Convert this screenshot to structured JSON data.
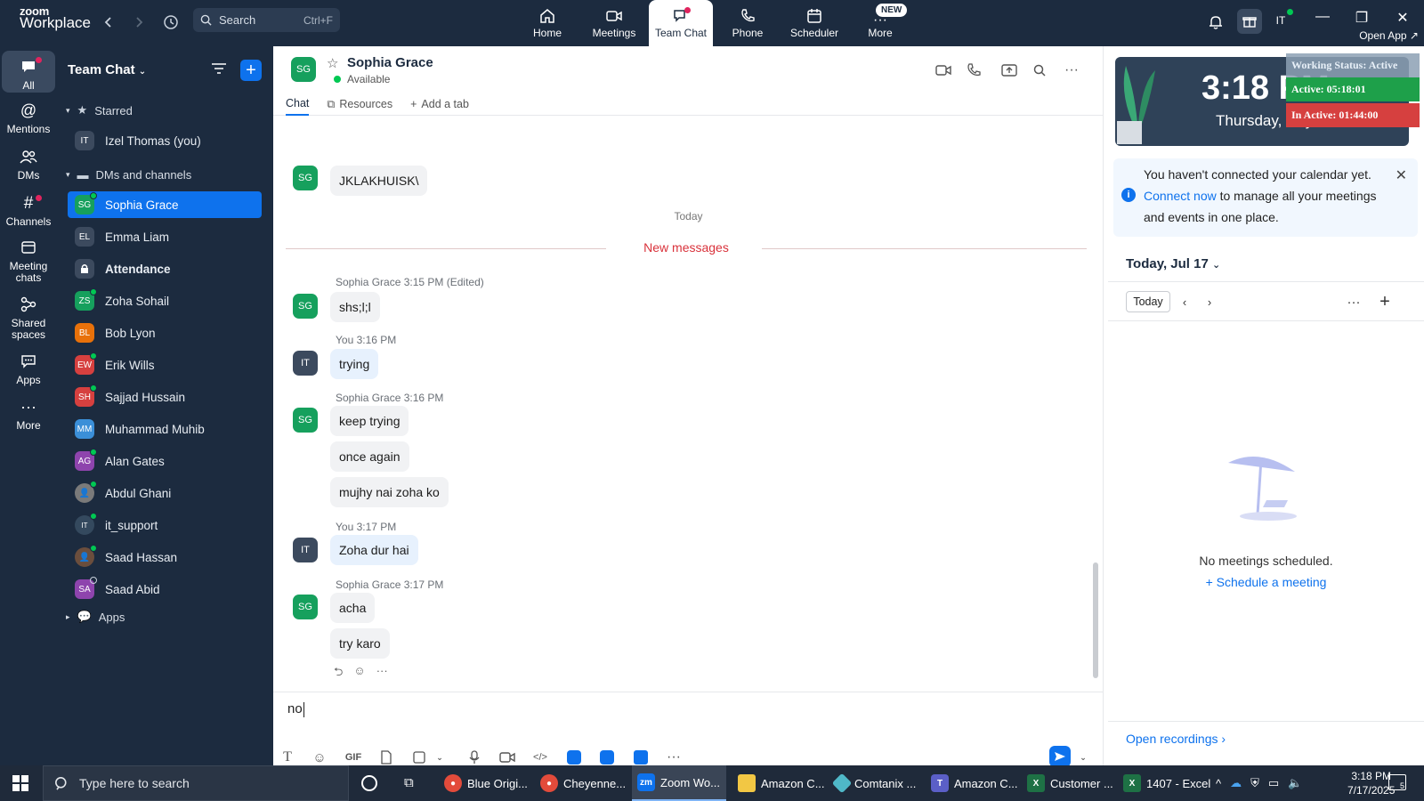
{
  "app": {
    "logo_line1": "zoom",
    "logo_line2": "Workplace",
    "search_label": "Search",
    "search_shortcut": "Ctrl+F",
    "nav": [
      {
        "label": "Home",
        "icon": "home-icon"
      },
      {
        "label": "Meetings",
        "icon": "video-icon"
      },
      {
        "label": "Team Chat",
        "icon": "chat-icon",
        "active": true
      },
      {
        "label": "Phone",
        "icon": "phone-icon"
      },
      {
        "label": "Scheduler",
        "icon": "calendar-icon"
      },
      {
        "label": "More",
        "icon": "more-icon"
      }
    ],
    "new_badge": "NEW",
    "user_initials": "IT",
    "open_app": "Open App ↗"
  },
  "rail": [
    {
      "label": "All",
      "icon": "chat-bubble-icon"
    },
    {
      "label": "Mentions",
      "icon": "at-icon"
    },
    {
      "label": "DMs",
      "icon": "people-icon"
    },
    {
      "label": "Channels",
      "icon": "hash-icon"
    },
    {
      "label": "Meeting chats",
      "icon": "meeting-chat-icon"
    },
    {
      "label": "Shared spaces",
      "icon": "shared-spaces-icon"
    },
    {
      "label": "Apps",
      "icon": "apps-icon"
    },
    {
      "label": "More",
      "icon": "more-dots-icon"
    }
  ],
  "sidebar": {
    "title": "Team Chat",
    "starred_label": "Starred",
    "starred_items": [
      {
        "initials": "IT",
        "name": "Izel Thomas (you)",
        "color": "#3c4a5e"
      }
    ],
    "dms_label": "DMs and channels",
    "items": [
      {
        "initials": "SG",
        "name": "Sophia Grace",
        "color": "#16a05d"
      },
      {
        "initials": "EL",
        "name": "Emma Liam",
        "color": "#3c4a5e"
      },
      {
        "initials": "",
        "name": "Attendance",
        "color": "#3c4a5e"
      },
      {
        "initials": "ZS",
        "name": "Zoha Sohail",
        "color": "#16a05d"
      },
      {
        "initials": "BL",
        "name": "Bob Lyon",
        "color": "#e8710a"
      },
      {
        "initials": "EW",
        "name": "Erik Wills",
        "color": "#d6403f"
      },
      {
        "initials": "SH",
        "name": "Sajjad Hussain",
        "color": "#d6403f"
      },
      {
        "initials": "MM",
        "name": "Muhammad Muhib",
        "color": "#3b8fd8"
      },
      {
        "initials": "AG",
        "name": "Alan Gates",
        "color": "#8e44ad"
      },
      {
        "initials": "",
        "name": "Abdul Ghani",
        "color": "#7a7a7a"
      },
      {
        "initials": "",
        "name": "it_support",
        "color": "#34495e"
      },
      {
        "initials": "",
        "name": "Saad Hassan",
        "color": "#6b4e3d"
      },
      {
        "initials": "SA",
        "name": "Saad Abid",
        "color": "#8e44ad"
      }
    ],
    "apps_label": "Apps"
  },
  "chat": {
    "contact_initials": "SG",
    "contact_name": "Sophia Grace",
    "contact_status": "Available",
    "tabs": [
      "Chat",
      "Resources",
      "Add a tab"
    ],
    "day_label": "Today",
    "new_messages_label": "New messages",
    "messages": [
      {
        "sender": "",
        "initials": "SG",
        "texts": [
          "JKLAKHUISK\\"
        ]
      },
      {
        "sender": "Sophia Grace 3:15 PM (Edited)",
        "initials": "SG",
        "texts": [
          "shs;l;l"
        ]
      },
      {
        "sender": "You 3:16 PM",
        "initials": "IT",
        "texts": [
          "trying"
        ]
      },
      {
        "sender": "Sophia Grace 3:16 PM",
        "initials": "SG",
        "texts": [
          "keep trying",
          "once again",
          "mujhy nai zoha ko"
        ]
      },
      {
        "sender": "You 3:17 PM",
        "initials": "IT",
        "texts": [
          "Zoha dur hai"
        ]
      },
      {
        "sender": "Sophia Grace 3:17 PM",
        "initials": "SG",
        "texts": [
          "acha",
          "try karo"
        ]
      }
    ],
    "composer_value": "no",
    "gif_label": "GIF"
  },
  "right_panel": {
    "clock_time": "3:18 PM",
    "clock_date": "Thursday, July 17",
    "working_status": "Working Status: Active",
    "active_time": "Active: 05:18:01",
    "inactive_time": "In Active: 01:44:00",
    "calendar_note_pre": "You haven't connected your calendar yet.",
    "calendar_note_link": "Connect now",
    "calendar_note_post": "to manage all your meetings and events in one place.",
    "day_heading": "Today, Jul 17",
    "today_button": "Today",
    "empty_text": "No meetings scheduled.",
    "schedule_link": "Schedule a meeting",
    "open_recordings": "Open recordings"
  },
  "taskbar": {
    "search_placeholder": "Type here to search",
    "apps": [
      {
        "label": "Blue Origi...",
        "icon": "chrome-icon"
      },
      {
        "label": "Cheyenne...",
        "icon": "chrome-icon"
      },
      {
        "label": "Zoom Wo...",
        "icon": "zoom-icon",
        "active": true
      },
      {
        "label": "Amazon C...",
        "icon": "folder-icon"
      },
      {
        "label": "Comtanix ...",
        "icon": "app-icon"
      },
      {
        "label": "Amazon C...",
        "icon": "teams-icon"
      },
      {
        "label": "Customer ...",
        "icon": "excel-icon"
      },
      {
        "label": "1407 - Excel",
        "icon": "excel-icon"
      }
    ],
    "time": "3:18 PM",
    "date": "7/17/2025",
    "notif_count": "5"
  }
}
